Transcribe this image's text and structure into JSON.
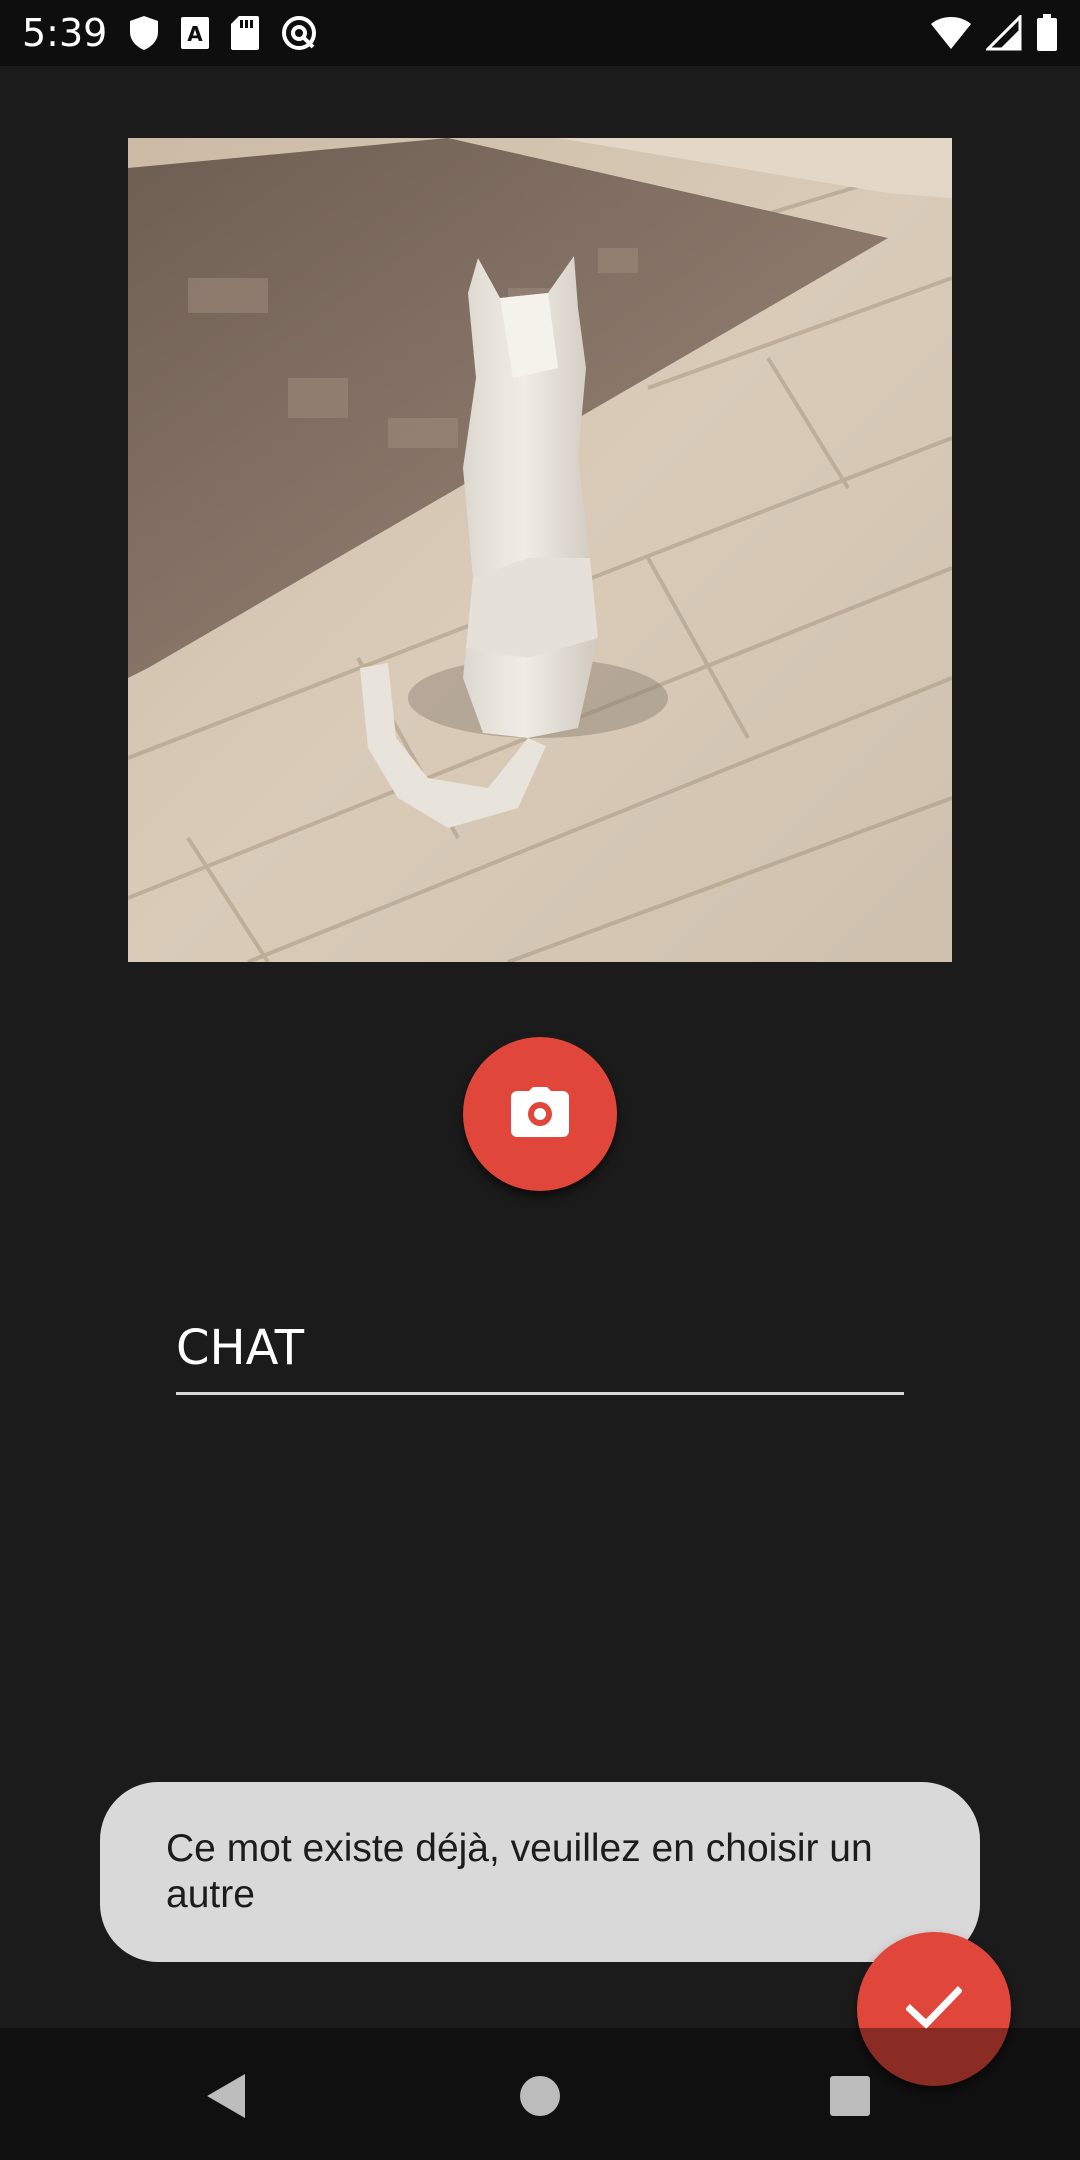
{
  "status_bar": {
    "time": "5:39",
    "left_icons": [
      "shield-icon",
      "font-a-icon",
      "sd-card-icon",
      "sync-icon"
    ],
    "right_icons": [
      "wifi-icon",
      "signal-icon",
      "battery-icon"
    ]
  },
  "photo": {
    "subject": "white low-poly cat figurine on wooden floor"
  },
  "camera_button": {
    "icon": "camera-icon",
    "accent": "#e0473a"
  },
  "word_input": {
    "value": "CHAT",
    "placeholder": ""
  },
  "toast": {
    "message": "Ce mot existe déjà, veuillez en choisir un autre"
  },
  "confirm_button": {
    "icon": "check-icon",
    "accent": "#e0473a"
  },
  "nav_bar": {
    "buttons": [
      "back-icon",
      "home-icon",
      "recents-icon"
    ]
  }
}
